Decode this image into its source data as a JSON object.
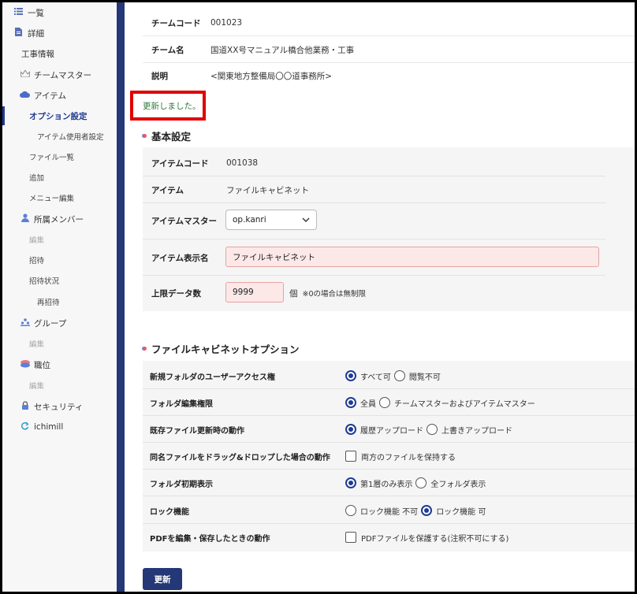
{
  "sidebar": {
    "items": [
      {
        "label": "一覧",
        "icon": "list-icon"
      },
      {
        "label": "詳細",
        "icon": "document-icon"
      },
      {
        "label": "工事情報"
      },
      {
        "label": "チームマスター",
        "icon": "crown-icon"
      },
      {
        "label": "アイテム",
        "icon": "cloud-icon"
      },
      {
        "label": "オプション設定",
        "active": true
      },
      {
        "label": "アイテム使用者設定"
      },
      {
        "label": "ファイル一覧"
      },
      {
        "label": "追加"
      },
      {
        "label": "メニュー編集"
      },
      {
        "label": "所属メンバー",
        "icon": "person-icon"
      },
      {
        "label": "編集",
        "disabled": true
      },
      {
        "label": "招待"
      },
      {
        "label": "招待状況"
      },
      {
        "label": "再招待"
      },
      {
        "label": "グループ",
        "icon": "group-icon"
      },
      {
        "label": "編集",
        "disabled": true
      },
      {
        "label": "職位",
        "icon": "layers-icon"
      },
      {
        "label": "編集",
        "disabled": true
      },
      {
        "label": "セキュリティ",
        "icon": "lock-icon"
      },
      {
        "label": "ichimill",
        "icon": "sync-icon"
      }
    ]
  },
  "team_info": {
    "code_label": "チームコード",
    "code_value": "001023",
    "name_label": "チーム名",
    "name_value": "国道XX号マニュアル橋合他業務・工事",
    "desc_label": "説明",
    "desc_value": "<関東地方整備局〇〇道事務所>"
  },
  "notice": "更新しました。",
  "basic": {
    "title": "基本設定",
    "item_code_label": "アイテムコード",
    "item_code_value": "001038",
    "item_label": "アイテム",
    "item_value": "ファイルキャビネット",
    "master_label": "アイテムマスター",
    "master_value": "op.kanri",
    "display_name_label": "アイテム表示名",
    "display_name_value": "ファイルキャビネット",
    "limit_label": "上限データ数",
    "limit_value": "9999",
    "limit_unit": "個",
    "limit_note": "※0の場合は無制限"
  },
  "options": {
    "title": "ファイルキャビネットオプション",
    "rows": [
      {
        "label": "新規フォルダのユーザーアクセス権",
        "type": "radio",
        "choices": [
          "すべて可",
          "閲覧不可"
        ],
        "selected": 0
      },
      {
        "label": "フォルダ編集権限",
        "type": "radio",
        "choices": [
          "全員",
          "チームマスターおよびアイテムマスター"
        ],
        "selected": 0
      },
      {
        "label": "既存ファイル更新時の動作",
        "type": "radio",
        "choices": [
          "履歴アップロード",
          "上書きアップロード"
        ],
        "selected": 0
      },
      {
        "label": "同名ファイルをドラッグ&ドロップした場合の動作",
        "type": "checkbox",
        "choices": [
          "両方のファイルを保持する"
        ]
      },
      {
        "label": "フォルダ初期表示",
        "type": "radio",
        "choices": [
          "第1層のみ表示",
          "全フォルダ表示"
        ],
        "selected": 0
      },
      {
        "label": "ロック機能",
        "type": "radio",
        "choices": [
          "ロック機能 不可",
          "ロック機能 可"
        ],
        "selected": 1
      },
      {
        "label": "PDFを編集・保存したときの動作",
        "type": "checkbox",
        "choices": [
          "PDFファイルを保護する(注釈不可にする)"
        ]
      }
    ]
  },
  "update_button": "更新",
  "colors": {
    "accent": "#243877",
    "notice_text": "#2f7a3a",
    "highlight_border": "#e00000",
    "input_error_bg": "#fde8e8"
  }
}
